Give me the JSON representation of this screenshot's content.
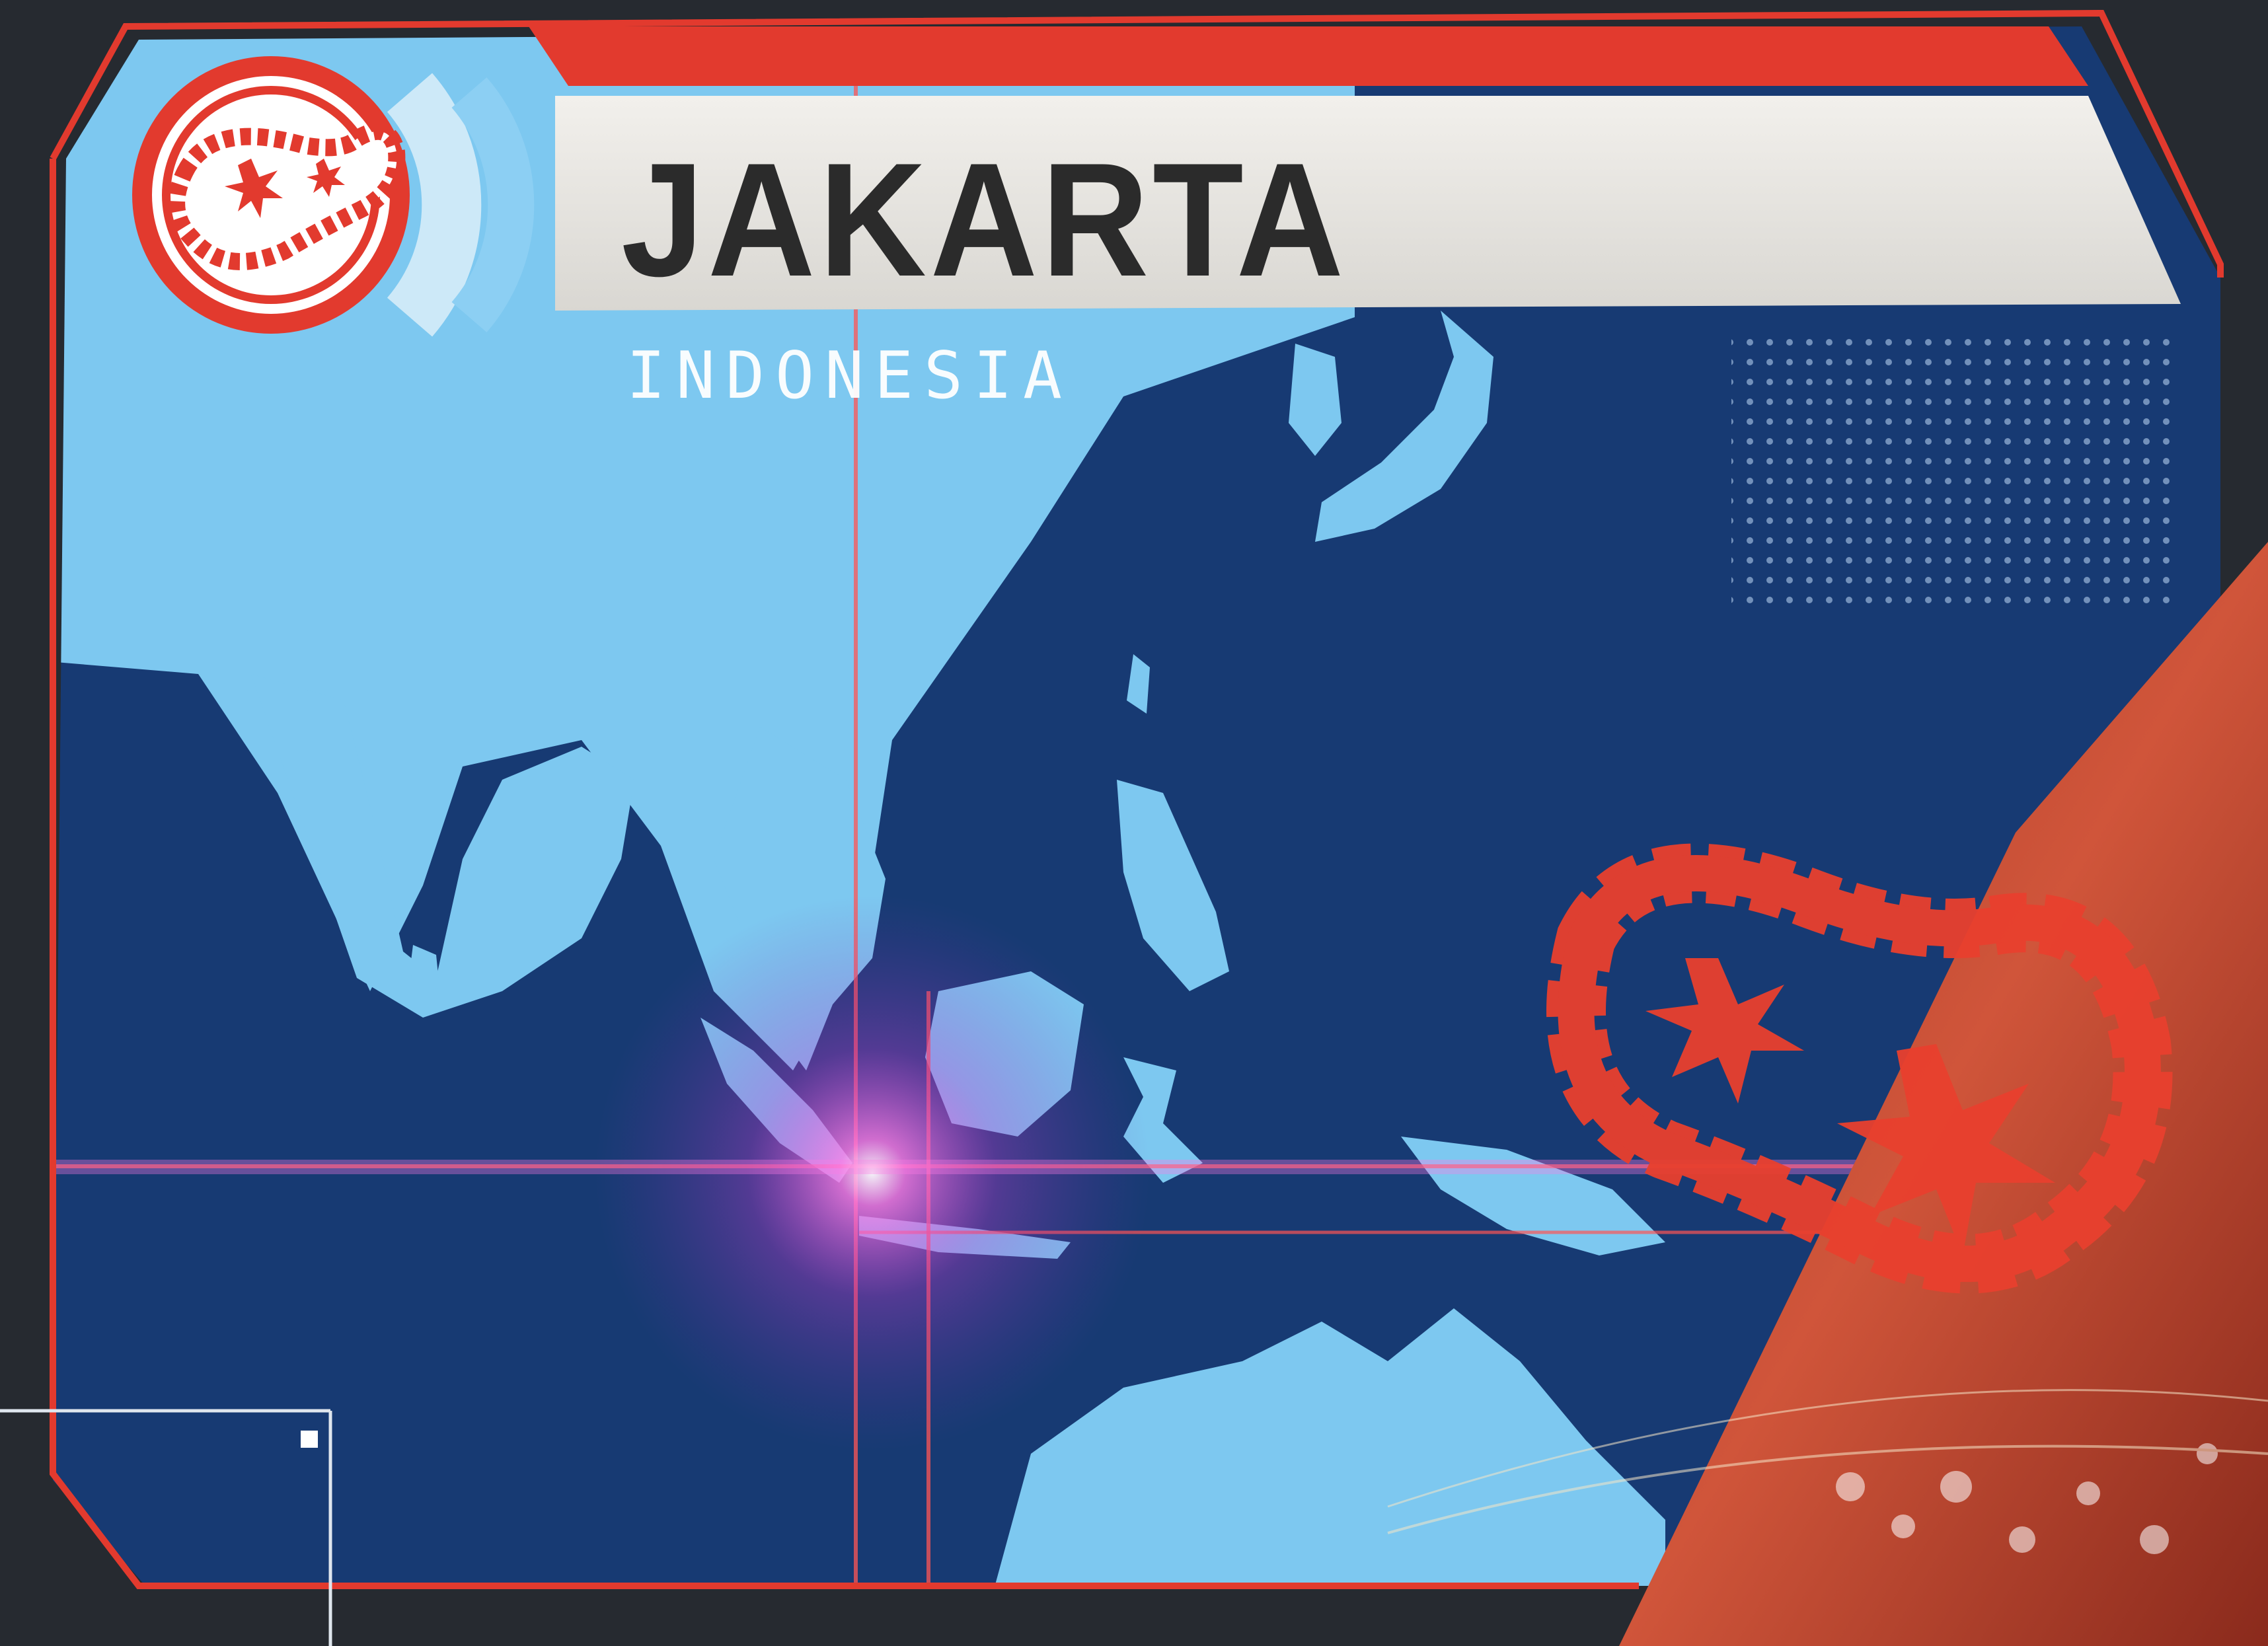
{
  "card": {
    "city": "JAKARTA",
    "country": "INDONESIA"
  },
  "colors": {
    "ocean": "#173a73",
    "land": "#7dc8f0",
    "panel_light": "#8ccff3",
    "title_band": "#e8e6e1",
    "accent_red": "#e23a2e",
    "glow_magenta": "#ff4fd8",
    "orange_corner": "#c4452c"
  },
  "icons": {
    "disease_badge": "germ-icon",
    "large_emblem": "germ-icon"
  }
}
